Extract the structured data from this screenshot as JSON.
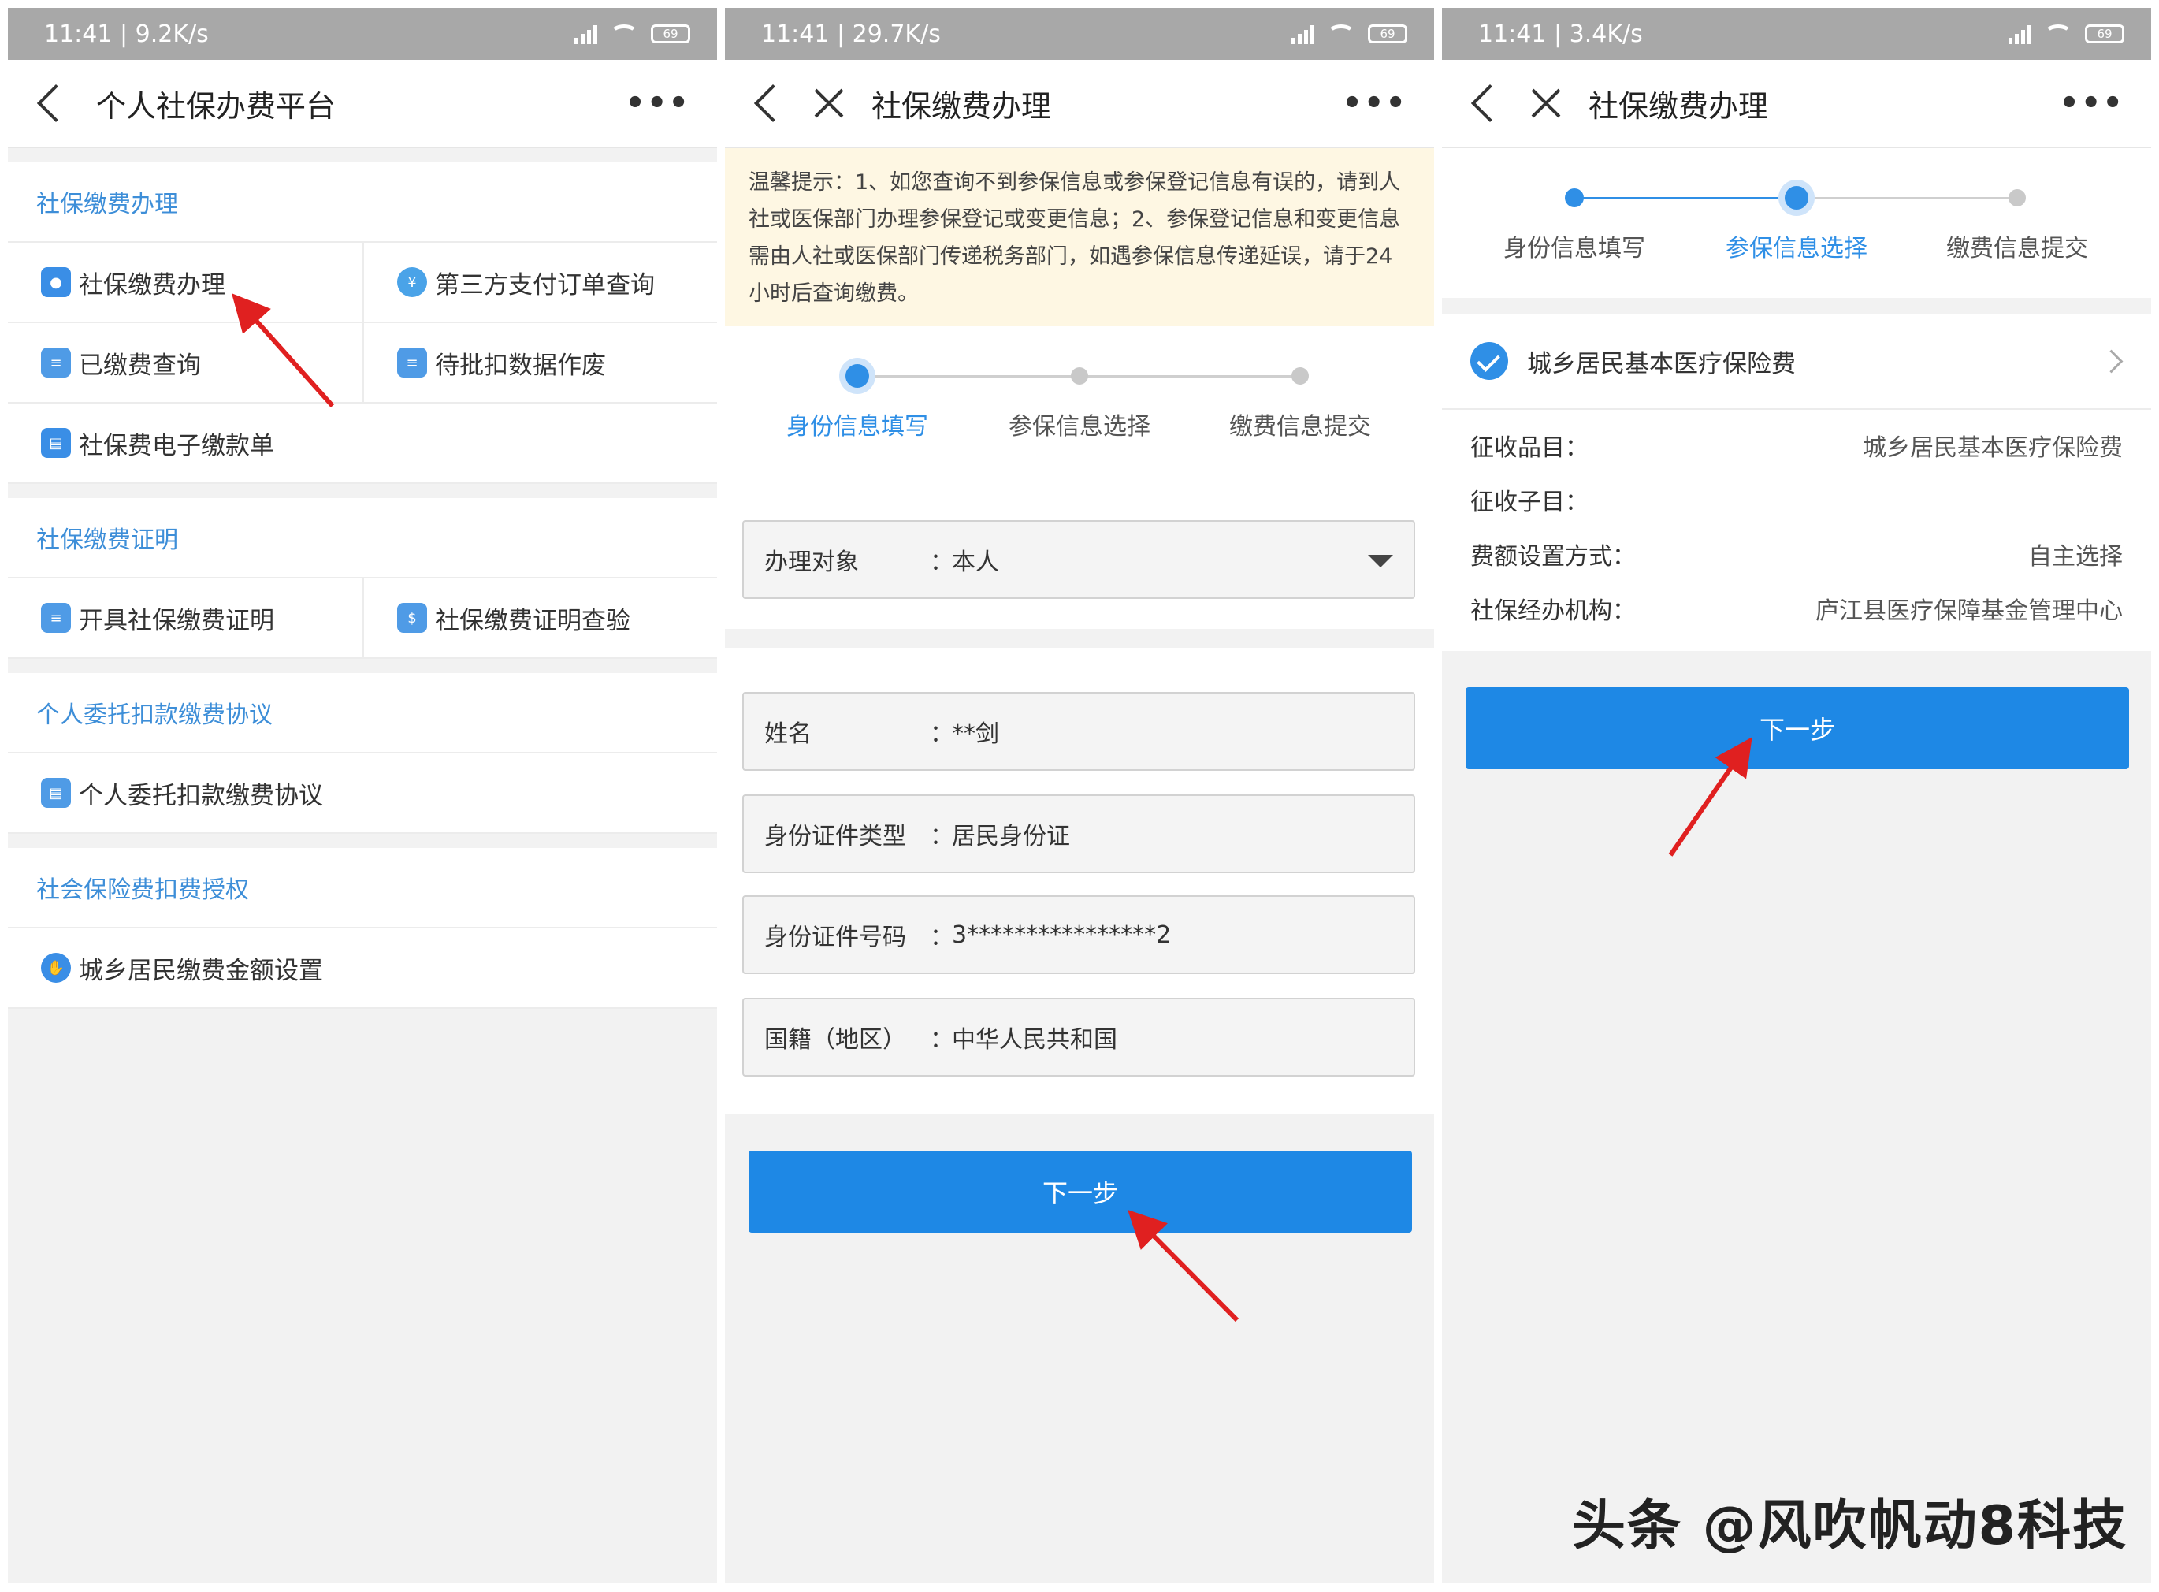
{
  "screens": [
    {
      "status": {
        "time": "11:41 | 9.2K/s",
        "battery": "69"
      },
      "title": "个人社保办费平台",
      "more": "•••",
      "sections": [
        {
          "title": "社保缴费办理",
          "items": [
            "社保缴费办理",
            "第三方支付订单查询",
            "已缴费查询",
            "待批扣数据作废",
            "社保费电子缴款单"
          ]
        },
        {
          "title": "社保缴费证明",
          "items": [
            "开具社保缴费证明",
            "社保缴费证明查验"
          ]
        },
        {
          "title": "个人委托扣款缴费协议",
          "items": [
            "个人委托扣款缴费协议"
          ]
        },
        {
          "title": "社会保险费扣费授权",
          "items": [
            "城乡居民缴费金额设置"
          ]
        }
      ]
    },
    {
      "status": {
        "time": "11:41 | 29.7K/s",
        "battery": "69"
      },
      "title": "社保缴费办理",
      "more": "•••",
      "notice": "温馨提示：1、如您查询不到参保信息或参保登记信息有误的，请到人社或医保部门办理参保登记或变更信息；2、参保登记信息和变更信息需由人社或医保部门传递税务部门，如遇参保信息传递延误，请于24小时后查询缴费。",
      "steps": [
        "身份信息填写",
        "参保信息选择",
        "缴费信息提交"
      ],
      "select": {
        "label": "办理对象",
        "value": "本人"
      },
      "fields": [
        {
          "label": "姓名",
          "value": "**剑"
        },
        {
          "label": "身份证件类型",
          "value": "居民身份证"
        },
        {
          "label": "身份证件号码",
          "value": "3****************2"
        },
        {
          "label": "国籍（地区）",
          "value": "中华人民共和国"
        }
      ],
      "colon": "：",
      "next": "下一步"
    },
    {
      "status": {
        "time": "11:41 | 3.4K/s",
        "battery": "69"
      },
      "title": "社保缴费办理",
      "more": "•••",
      "steps": [
        "身份信息填写",
        "参保信息选择",
        "缴费信息提交"
      ],
      "insurance": "城乡居民基本医疗保险费",
      "details": [
        {
          "k": "征收品目：",
          "v": "城乡居民基本医疗保险费"
        },
        {
          "k": "征收子目：",
          "v": ""
        },
        {
          "k": "费额设置方式：",
          "v": "自主选择"
        },
        {
          "k": "社保经办机构：",
          "v": "庐江县医疗保障基金管理中心"
        }
      ],
      "next": "下一步"
    }
  ],
  "watermark": "头条 @风吹帆动8科技",
  "colors": {
    "accent": "#1e88e5",
    "section_title": "#3d8ed8",
    "arrow": "#e02020",
    "notice_bg": "#fef7e3"
  },
  "icons": [
    "back-icon",
    "close-icon",
    "more-icon",
    "check-icon",
    "chevron-right-icon",
    "dropdown-caret-icon"
  ]
}
